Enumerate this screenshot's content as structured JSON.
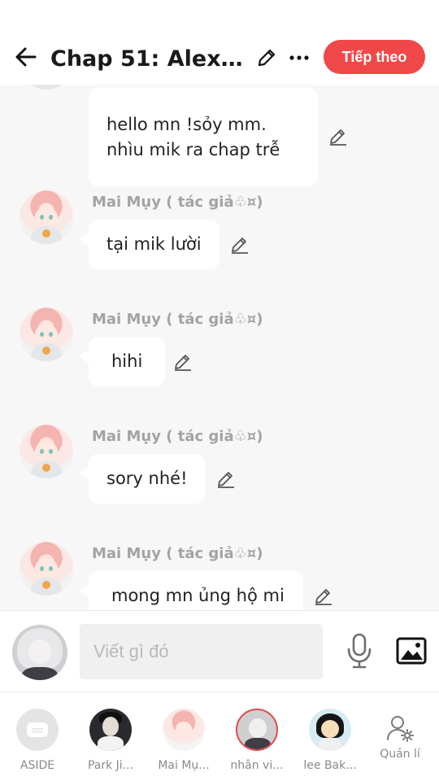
{
  "header": {
    "title": "Chap 51: Alex v...",
    "next_label": "Tiếp theo"
  },
  "messages": [
    {
      "author": "",
      "lines": [
        "hello mn !sỏy mm.",
        "nhìu mik ra chap trễ"
      ]
    },
    {
      "author": "Mai Mụy ( tác giả♧¤)",
      "text": "tại mik lười"
    },
    {
      "author": "Mai Mụy ( tác giả♧¤)",
      "text": "hihi"
    },
    {
      "author": "Mai Mụy ( tác giả♧¤)",
      "text": "sory nhé!"
    },
    {
      "author": "Mai Mụy ( tác giả♧¤)",
      "text": "mong mn ủng hộ mi"
    }
  ],
  "input": {
    "placeholder": "Viết gì đó"
  },
  "cast": [
    {
      "label": "ASIDE"
    },
    {
      "label": "Park Ji..."
    },
    {
      "label": "Mai Mụ..."
    },
    {
      "label": "nhân vi..."
    },
    {
      "label": "lee Bak..."
    },
    {
      "label": "Quản lí"
    }
  ],
  "colors": {
    "accent": "#f04848",
    "background": "#f7f7f7",
    "author_text": "#a3a3a3",
    "bubble": "#ffffff"
  },
  "icons": {
    "back": "arrow-left-icon",
    "edit": "pencil-icon",
    "more": "more-dots-icon",
    "mic": "microphone-icon",
    "image": "image-icon",
    "aside": "chat-bubble-icon",
    "manage": "user-gear-icon"
  }
}
